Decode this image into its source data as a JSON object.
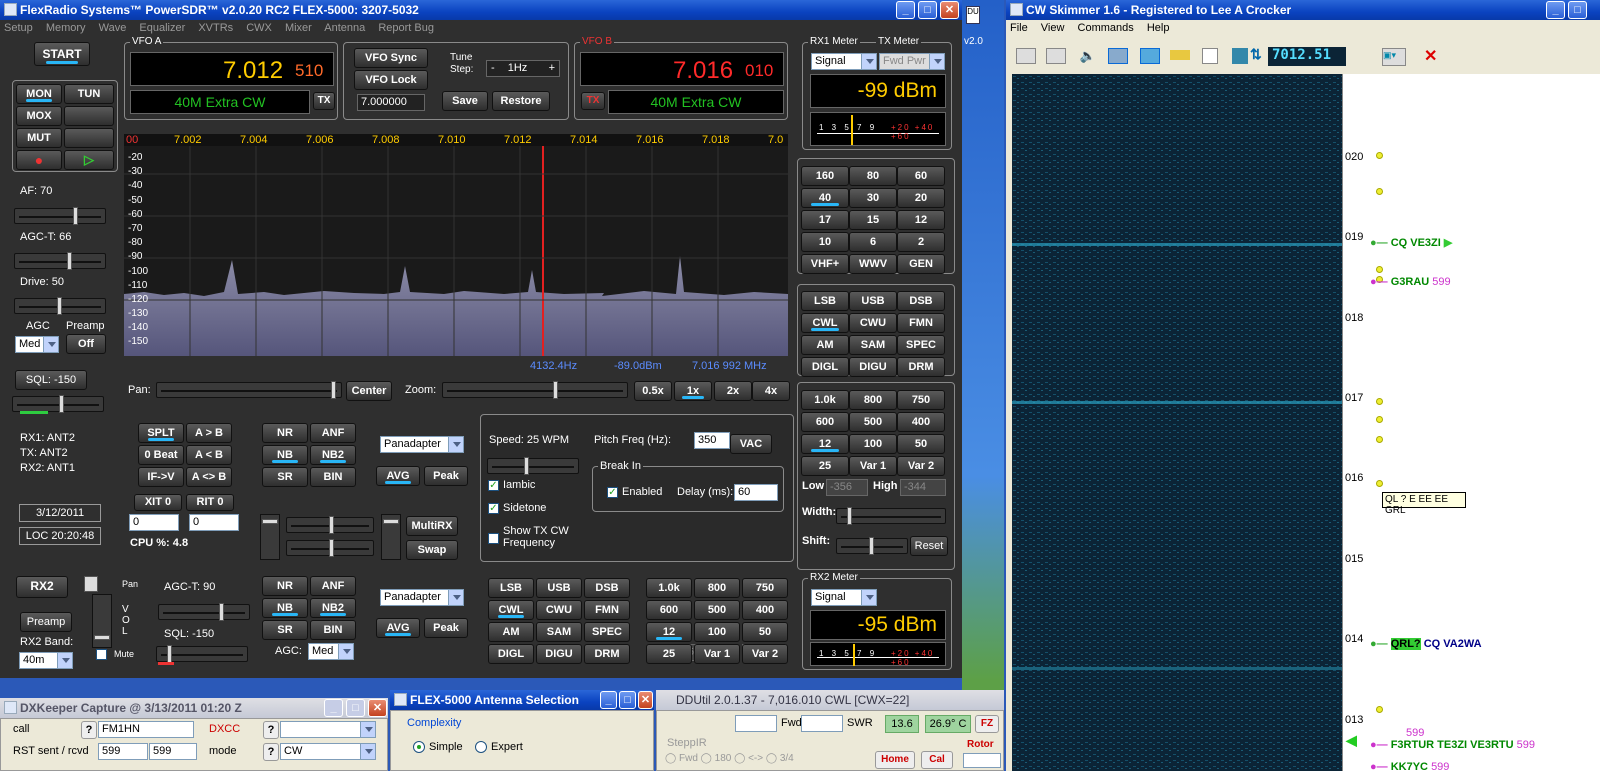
{
  "psdr": {
    "title": "FlexRadio Systems™ PowerSDR™ v2.0.20  RC2   FLEX-5000:  3207-5032",
    "menu": [
      "Setup",
      "Memory",
      "Wave",
      "Equalizer",
      "XVTRs",
      "CWX",
      "Mixer",
      "Antenna",
      "Report Bug"
    ],
    "start": "START",
    "mon": "MON",
    "tun": "TUN",
    "mox": "MOX",
    "mut": "MUT",
    "af": "AF:  70",
    "agct": "AGC-T:  66",
    "drive": "Drive:  50",
    "agc": "AGC",
    "preamp": "Preamp",
    "agc_val": "Med",
    "preamp_val": "Off",
    "sql": "SQL:  -150",
    "rx1ant": "RX1: ANT2",
    "txant": "TX: ANT2",
    "rx2ant": "RX2: ANT1",
    "date": "3/12/2011",
    "time": "LOC 20:20:48",
    "vfoa_label": "VFO A",
    "vfoa_mhz": "7.012",
    "vfoa_khz": "510",
    "vfoa_band": "40M Extra CW",
    "tx_a": "TX",
    "vfob_label": "VFO B",
    "vfob_mhz": "7.016",
    "vfob_khz": "010",
    "vfob_band": "40M Extra CW",
    "tx_b": "TX",
    "vfo_sync": "VFO Sync",
    "vfo_lock": "VFO Lock",
    "vfo_entry": "7.000000",
    "tune_step_lbl": "Tune\nStep:",
    "tune_step": "1Hz",
    "save": "Save",
    "restore": "Restore",
    "rx1meter": "RX1 Meter",
    "txmeter": "TX Meter",
    "signal": "Signal",
    "fwdpwr": "Fwd Pwr",
    "rx1dbm": "-99 dBm",
    "rx2meter": "RX2 Meter",
    "rx2dbm": "-95 dBm",
    "xaxis": [
      "00",
      "7.002",
      "7.004",
      "7.006",
      "7.008",
      "7.010",
      "7.012",
      "7.014",
      "7.016",
      "7.018",
      "7.0"
    ],
    "yaxis": [
      "-20",
      "-30",
      "-40",
      "-50",
      "-60",
      "-70",
      "-80",
      "-90",
      "-100",
      "-110",
      "-120",
      "-130",
      "-140",
      "-150"
    ],
    "cursor_hz": "4132.4Hz",
    "cursor_dbm": "-89.0dBm",
    "cursor_mhz": "7.016 992 MHz",
    "pan": "Pan:",
    "center": "Center",
    "zoom": "Zoom:",
    "zooms": [
      "0.5x",
      "1x",
      "2x",
      "4x"
    ],
    "bands": [
      "160",
      "80",
      "60",
      "40",
      "30",
      "20",
      "17",
      "15",
      "12",
      "10",
      "6",
      "2",
      "VHF+",
      "WWV",
      "GEN"
    ],
    "modes": [
      "LSB",
      "USB",
      "DSB",
      "CWL",
      "CWU",
      "FMN",
      "AM",
      "SAM",
      "SPEC",
      "DIGL",
      "DIGU",
      "DRM"
    ],
    "filters": [
      "1.0k",
      "800",
      "750",
      "600",
      "500",
      "400",
      "12",
      "100",
      "50",
      "25",
      "Var 1",
      "Var 2"
    ],
    "low": "Low",
    "low_val": "-356",
    "high": "High",
    "high_val": "-344",
    "width": "Width:",
    "shift": "Shift:",
    "reset": "Reset",
    "splt": "SPLT",
    "atob": "A > B",
    "zerobeat": "0 Beat",
    "btoa": "A < B",
    "ifv": "IF->V",
    "aswap": "A <> B",
    "xit": "XIT",
    "xit_v": "0",
    "rit": "RIT",
    "rit_v": "0",
    "xit_box": "0",
    "rit_box": "0",
    "cpu": "CPU %:  4.8",
    "nr": "NR",
    "anf": "ANF",
    "nb": "NB",
    "nb2": "NB2",
    "sr": "SR",
    "bin": "BIN",
    "panadapter": "Panadapter",
    "avg": "AVG",
    "peak": "Peak",
    "speed": "Speed:  25 WPM",
    "pitch": "Pitch Freq (Hz):",
    "pitch_v": "350",
    "vac": "VAC",
    "iambic": "Iambic",
    "sidetone": "Sidetone",
    "showtx": "Show TX CW\nFrequency",
    "breakin": "Break In",
    "enabled": "Enabled",
    "delay": "Delay (ms):",
    "delay_v": "60",
    "multirx": "MultiRX",
    "swap": "Swap",
    "rx2": "RX2",
    "pan2": "Pan",
    "vol": "V\nO\nL",
    "mute": "Mute",
    "rx2preamp": "Preamp",
    "rx2band": "RX2 Band:",
    "rx2band_v": "40m",
    "agct2": "AGC-T:  90",
    "sql2": "SQL:  -150",
    "agc2": "AGC:",
    "agc2_v": "Med",
    "side_v": "v2.0"
  },
  "skimmer": {
    "title": "CW Skimmer 1.6 - Registered to Lee A Crocker",
    "menu": [
      "File",
      "View",
      "Commands",
      "Help"
    ],
    "freq": "7012.51",
    "ticks": [
      "020",
      "019",
      "018",
      "017",
      "016",
      "015",
      "014",
      "013"
    ],
    "spots": [
      {
        "call": "CQ VE3ZI",
        "rst": ""
      },
      {
        "call": "G3RAU",
        "rst": "599"
      },
      {
        "call": "CQ VA2WA",
        "rst": ""
      },
      {
        "call": "F3RTUR TE3ZI VE3RTU",
        "rst": "599"
      },
      {
        "call": "KK7YC",
        "rst": "599"
      }
    ],
    "qrl": "QRL?",
    "tooltip": "QL ? E EE EE GRL",
    "rst_top": "599"
  },
  "dxk": {
    "title": "DXKeeper Capture @ 3/13/2011   01:20 Z",
    "call": "call",
    "q": "?",
    "call_v": "FM1HN",
    "dxcc": "DXCC",
    "rst": "RST sent / rcvd",
    "rst_s": "599",
    "rst_r": "599",
    "mode": "mode",
    "mode_v": "CW"
  },
  "ant": {
    "title": "FLEX-5000 Antenna Selection",
    "complexity": "Complexity",
    "simple": "Simple",
    "expert": "Expert"
  },
  "ddu": {
    "title": "DDUtil 2.0.1.37 - 7,016.010  CWL  [CWX=22]",
    "fwd": "Fwd",
    "swr": "SWR",
    "v1": "13.6",
    "v2": "26.9° C",
    "fz": "FZ",
    "stepp": "SteppIR",
    "opts": [
      "Fwd",
      "180",
      "<->",
      "3/4"
    ],
    "home": "Home",
    "cal": "Cal",
    "rotor": "Rotor"
  }
}
